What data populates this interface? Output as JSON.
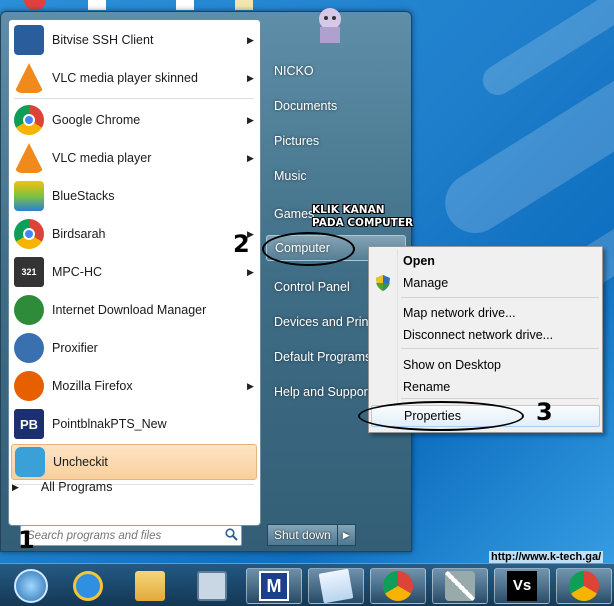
{
  "programs": [
    {
      "label": "Bitvise SSH Client",
      "icon": "bitvise-icon",
      "color": "#2a5d9c",
      "arrow": true
    },
    {
      "label": "VLC media player skinned",
      "icon": "vlc-icon",
      "color": "#f08a1c",
      "arrow": true
    },
    {
      "label": "Google Chrome",
      "icon": "chrome-icon",
      "color": "#db4437",
      "arrow": true
    },
    {
      "label": "VLC media player",
      "icon": "vlc-icon",
      "color": "#f08a1c",
      "arrow": true
    },
    {
      "label": "BlueStacks",
      "icon": "bluestacks-icon",
      "color": "#7cc242",
      "arrow": false
    },
    {
      "label": "Birdsarah",
      "icon": "chrome-icon",
      "color": "#db4437",
      "arrow": true
    },
    {
      "label": "MPC-HC",
      "icon": "mpc-hc-icon",
      "color": "#333333",
      "arrow": true
    },
    {
      "label": "Internet Download Manager",
      "icon": "idm-icon",
      "color": "#2e8b3a",
      "arrow": false
    },
    {
      "label": "Proxifier",
      "icon": "proxifier-icon",
      "color": "#3a6fb0",
      "arrow": false
    },
    {
      "label": "Mozilla Firefox",
      "icon": "firefox-icon",
      "color": "#e66000",
      "arrow": true
    },
    {
      "label": "PointblnakPTS_New",
      "icon": "pointblank-icon",
      "color": "#1c2f6e",
      "arrow": false
    },
    {
      "label": "Uncheckit",
      "icon": "uncheckit-icon",
      "color": "#3aa0d8",
      "arrow": false
    }
  ],
  "all_programs": "All Programs",
  "search": {
    "placeholder": "Search programs and files"
  },
  "right_pane": {
    "items": [
      "NICKO",
      "Documents",
      "Pictures",
      "Music",
      "Games",
      "Computer",
      "Control Panel",
      "Devices and Printers",
      "Default Programs",
      "Help and Support"
    ]
  },
  "shutdown": {
    "label": "Shut down"
  },
  "context_menu": {
    "items": [
      "Open",
      "Manage",
      "Map network drive...",
      "Disconnect network drive...",
      "Show on Desktop",
      "Rename",
      "Properties"
    ]
  },
  "annotations": {
    "step1": "1",
    "step2": "2",
    "step3": "3",
    "note_line1": "KLIK KANAN",
    "note_line2": "PADA COMPUTER",
    "url": "http://www.k-tech.ga/"
  },
  "taskbar": {
    "items": [
      "start-orb-icon",
      "internet-explorer-icon",
      "file-explorer-icon",
      "network-tool-icon",
      "m-app-icon",
      "notepad-icon",
      "chrome-icon",
      "tools-icon",
      "visual-studio-icon",
      "chrome-icon"
    ]
  },
  "colors": {
    "accent": "#1f7fcc",
    "menu_bg": "#3f6d86",
    "highlight": "#f9cf9c"
  }
}
